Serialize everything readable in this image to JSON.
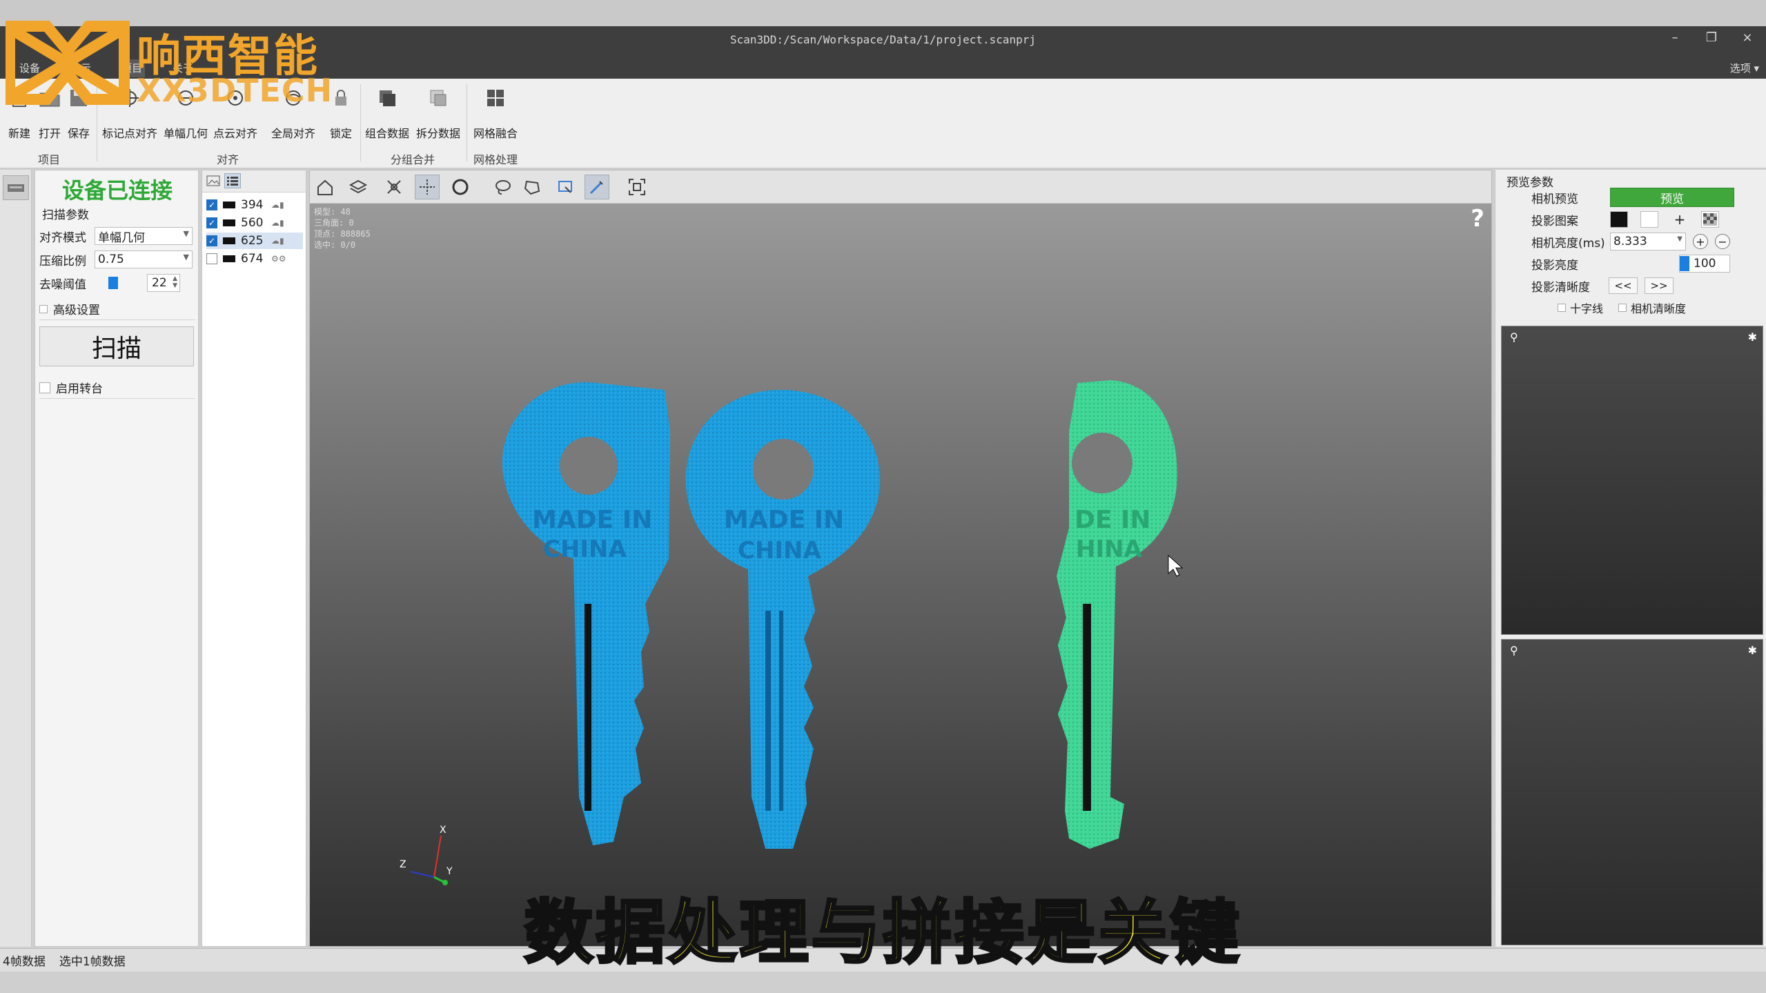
{
  "window": {
    "title": "Scan3DD:/Scan/Workspace/Data/1/project.scanprj",
    "minimize": "–",
    "restore": "❐",
    "close": "×",
    "options_label": "选项 ▾"
  },
  "menu": [
    "设备",
    "显示",
    "项目",
    "关于"
  ],
  "logo": {
    "chinese": "响西智能",
    "english": "XX3DTECH"
  },
  "ribbon": {
    "buttons": [
      "新建",
      "打开",
      "保存",
      "标记点对齐",
      "单幅几何",
      "点云对齐",
      "全局对齐",
      "锁定",
      "组合数据",
      "拆分数据",
      "网格融合"
    ],
    "groups": [
      "项目",
      "对齐",
      "分组合并",
      "网格处理"
    ]
  },
  "scan_panel": {
    "status": "设备已连接",
    "section": "扫描参数",
    "align_mode_label": "对齐模式",
    "align_mode_value": "单幅几何",
    "compress_label": "压缩比例",
    "compress_value": "0.75",
    "denoise_label": "去噪阈值",
    "denoise_value": "22",
    "denoise_level": 0.15,
    "advanced_label": "高级设置",
    "scan_button": "扫描",
    "turntable_label": "启用转台"
  },
  "data_list": [
    {
      "id": "394",
      "checked": true,
      "icons": "☁▮"
    },
    {
      "id": "560",
      "checked": true,
      "icons": "☁▮"
    },
    {
      "id": "625",
      "checked": true,
      "icons": "☁▮"
    },
    {
      "id": "674",
      "checked": false,
      "icons": "⚙⚙"
    }
  ],
  "viewport": {
    "stats": [
      "模型: 48",
      "三角面: 0",
      "顶点: 888865",
      "选中: 0/0"
    ],
    "help": "?",
    "axes": {
      "x": "X",
      "y": "Y",
      "z": "Z"
    },
    "subtitle": "数据处理与拼接是关键"
  },
  "right_panel": {
    "title": "预览参数",
    "camera_preview_label": "相机预览",
    "preview_button": "预览",
    "pattern_label": "投影图案",
    "camera_brightness_label": "相机亮度(ms)",
    "camera_brightness_value": "8.333",
    "projection_brightness_label": "投影亮度",
    "projection_brightness_value": "100",
    "projection_clarity_label": "投影清晰度",
    "prev": "<<",
    "next": ">>",
    "crosshair_label": "十字线",
    "camera_clarity_label": "相机清晰度"
  },
  "status_bar": {
    "frames": "4帧数据",
    "selected": "选中1帧数据"
  },
  "colors": {
    "connected_green": "#2ea836",
    "preview_green": "#3fa73b",
    "key_blue": "#1c9fe0",
    "key_green": "#3fd696",
    "subtitle_yellow": "#f3e634",
    "logo_orange": "#f1a52a"
  }
}
